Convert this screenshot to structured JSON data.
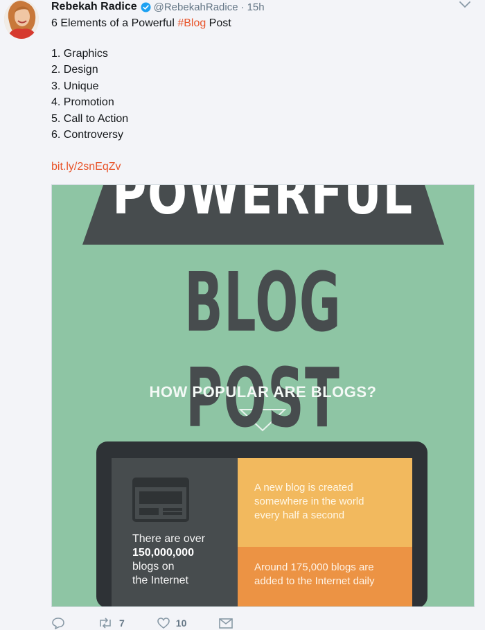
{
  "tweet": {
    "author_name": "Rebekah Radice",
    "handle": "@RebekahRadice",
    "separator": "·",
    "time": "15h",
    "text_prefix": "6 Elements of a Powerful ",
    "hashtag": "#Blog",
    "text_suffix": " Post",
    "list": [
      "1. Graphics",
      "2. Design",
      "3. Unique",
      "4. Promotion",
      "5. Call to Action",
      "6. Controversy"
    ],
    "link": "bit.ly/2snEqZv"
  },
  "infographic": {
    "banner_top": "POWERFUL",
    "title": "BLOG POST",
    "question": "HOW POPULAR ARE BLOGS?",
    "stat_left_line1": "There are over",
    "stat_left_number": "150,000,000",
    "stat_left_line3": "blogs on",
    "stat_left_line4": "the Internet",
    "stat_right_top_1": "A new blog is created",
    "stat_right_top_2": "somewhere in the world",
    "stat_right_top_3": "every half a second",
    "stat_right_bottom_1": "Around 175,000 blogs are",
    "stat_right_bottom_2": "added to the Internet daily",
    "colors": {
      "background": "#8ec5a4",
      "dark": "#474c4e",
      "yellow": "#f2b95e",
      "orange": "#ec9344"
    }
  },
  "actions": {
    "reply_icon": "reply-icon",
    "retweet_count": "7",
    "like_count": "10",
    "dm_icon": "message-icon"
  },
  "colors": {
    "accent": "#e8542a",
    "muted": "#657786",
    "verified": "#1da1f2"
  }
}
